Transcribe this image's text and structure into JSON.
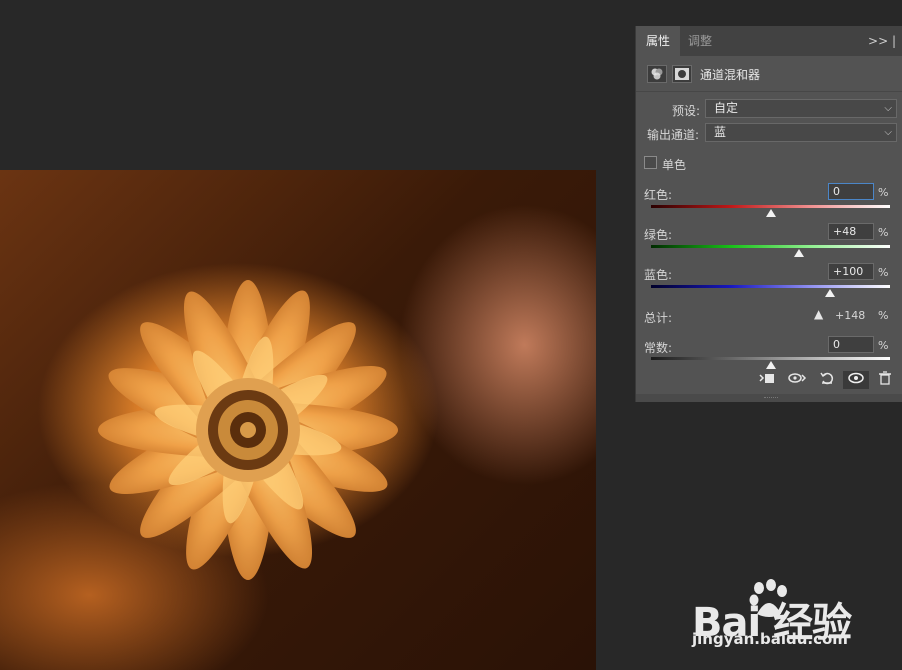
{
  "panel": {
    "tabs": [
      {
        "label": "属性",
        "active": true
      },
      {
        "label": "调整",
        "active": false
      }
    ],
    "menu_glyph": ">>  |",
    "adjustment_title": "通道混和器",
    "preset": {
      "label": "预设:",
      "value": "自定"
    },
    "output_channel": {
      "label": "输出通道:",
      "value": "蓝"
    },
    "monochrome": {
      "label": "单色",
      "checked": false
    },
    "channels": [
      {
        "label": "红色:",
        "value": "0",
        "percent": "%",
        "gradient": [
          "#2a0000",
          "#c01818",
          "#f09090",
          "#ffffff"
        ],
        "position": 0.5
      },
      {
        "label": "绿色:",
        "value": "+48",
        "percent": "%",
        "gradient": [
          "#002a00",
          "#18c018",
          "#90f090",
          "#ffffff"
        ],
        "position": 0.62
      },
      {
        "label": "蓝色:",
        "value": "+100",
        "percent": "%",
        "gradient": [
          "#00002a",
          "#1818c0",
          "#9090f0",
          "#ffffff"
        ],
        "position": 0.75
      }
    ],
    "total": {
      "label": "总计:",
      "value": "+148",
      "percent": "%"
    },
    "constant": {
      "label": "常数:",
      "value": "0",
      "percent": "%",
      "position": 0.5
    },
    "toolbar_icons": [
      "clip-to-layer-icon",
      "view-previous-icon",
      "reset-icon",
      "visibility-eye-icon",
      "trash-icon"
    ]
  },
  "watermark": {
    "logo": "Bai  经验",
    "url": "jingyan.baidu.com"
  },
  "colors": {
    "panel_bg": "#535353",
    "app_bg": "#282828",
    "focus_border": "#4b86c8"
  }
}
